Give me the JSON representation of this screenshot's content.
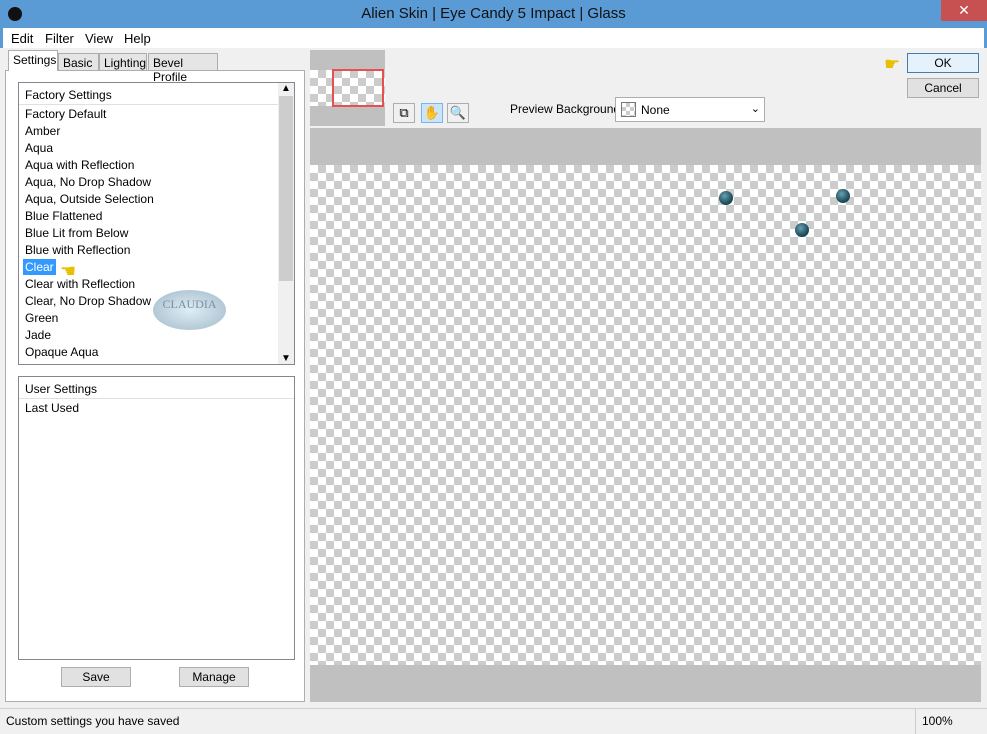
{
  "window": {
    "title": "Alien Skin | Eye Candy 5 Impact | Glass",
    "close": "✕"
  },
  "menu": [
    "Edit",
    "Filter",
    "View",
    "Help"
  ],
  "tabs": [
    "Settings",
    "Basic",
    "Lighting",
    "Bevel Profile"
  ],
  "factory": {
    "header": "Factory Settings",
    "selected": "Clear",
    "items": [
      "Factory Default",
      "Amber",
      "Aqua",
      "Aqua with Reflection",
      "Aqua, No Drop Shadow",
      "Aqua, Outside Selection",
      "Blue Flattened",
      "Blue Lit from Below",
      "Blue with Reflection",
      "Clear",
      "Clear with Reflection",
      "Clear, No Drop Shadow",
      "Green",
      "Jade",
      "Opaque Aqua"
    ]
  },
  "user": {
    "header": "User Settings",
    "items": [
      "Last Used"
    ]
  },
  "buttons": {
    "save": "Save",
    "manage": "Manage",
    "ok": "OK",
    "cancel": "Cancel"
  },
  "preview": {
    "background_label": "Preview Background:",
    "background_value": "None"
  },
  "status": {
    "text": "Custom settings you have saved",
    "zoom": "100%"
  },
  "watermark": "CLAUDIA"
}
